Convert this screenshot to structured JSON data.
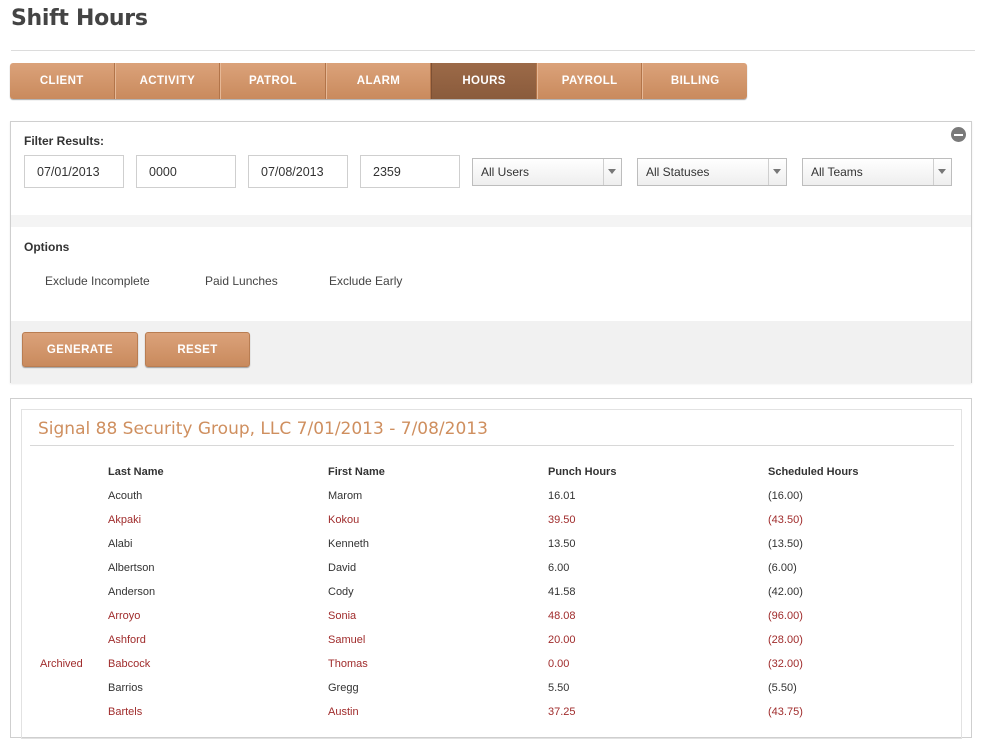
{
  "page": {
    "title": "Shift Hours"
  },
  "tabs": [
    {
      "label": "CLIENT",
      "active": false
    },
    {
      "label": "ACTIVITY",
      "active": false
    },
    {
      "label": "PATROL",
      "active": false
    },
    {
      "label": "ALARM",
      "active": false
    },
    {
      "label": "HOURS",
      "active": true
    },
    {
      "label": "PAYROLL",
      "active": false
    },
    {
      "label": "BILLING",
      "active": false
    }
  ],
  "filter": {
    "label": "Filter Results:",
    "start_date": "07/01/2013",
    "start_time": "0000",
    "end_date": "07/08/2013",
    "end_time": "2359",
    "users_select": "All Users",
    "statuses_select": "All Statuses",
    "teams_select": "All Teams",
    "collapse_icon": "minus-circle-icon"
  },
  "options": {
    "label": "Options",
    "exclude_incomplete": "Exclude Incomplete",
    "paid_lunches": "Paid Lunches",
    "exclude_early": "Exclude Early"
  },
  "actions": {
    "generate": "GENERATE",
    "reset": "RESET"
  },
  "report": {
    "title": "Signal 88 Security Group, LLC 7/01/2013 - 7/08/2013",
    "columns": {
      "last_name": "Last Name",
      "first_name": "First Name",
      "punch_hours": "Punch Hours",
      "scheduled_hours": "Scheduled Hours"
    },
    "rows": [
      {
        "status": "",
        "last": "Acouth",
        "first": "Marom",
        "punch": "16.01",
        "scheduled": "(16.00)",
        "alert": false
      },
      {
        "status": "",
        "last": "Akpaki",
        "first": "Kokou",
        "punch": "39.50",
        "scheduled": "(43.50)",
        "alert": true
      },
      {
        "status": "",
        "last": "Alabi",
        "first": "Kenneth",
        "punch": "13.50",
        "scheduled": "(13.50)",
        "alert": false
      },
      {
        "status": "",
        "last": "Albertson",
        "first": "David",
        "punch": "6.00",
        "scheduled": "(6.00)",
        "alert": false
      },
      {
        "status": "",
        "last": "Anderson",
        "first": "Cody",
        "punch": "41.58",
        "scheduled": "(42.00)",
        "alert": false
      },
      {
        "status": "",
        "last": "Arroyo",
        "first": "Sonia",
        "punch": "48.08",
        "scheduled": "(96.00)",
        "alert": true
      },
      {
        "status": "",
        "last": "Ashford",
        "first": "Samuel",
        "punch": "20.00",
        "scheduled": "(28.00)",
        "alert": true
      },
      {
        "status": "Archived",
        "last": "Babcock",
        "first": "Thomas",
        "punch": "0.00",
        "scheduled": "(32.00)",
        "alert": true
      },
      {
        "status": "",
        "last": "Barrios",
        "first": "Gregg",
        "punch": "5.50",
        "scheduled": "(5.50)",
        "alert": false
      },
      {
        "status": "",
        "last": "Bartels",
        "first": "Austin",
        "punch": "37.25",
        "scheduled": "(43.75)",
        "alert": true
      }
    ]
  },
  "colors": {
    "accent": "#cf8f5f",
    "tab_active": "#8f5f40",
    "alert_text": "#a02c2c"
  }
}
